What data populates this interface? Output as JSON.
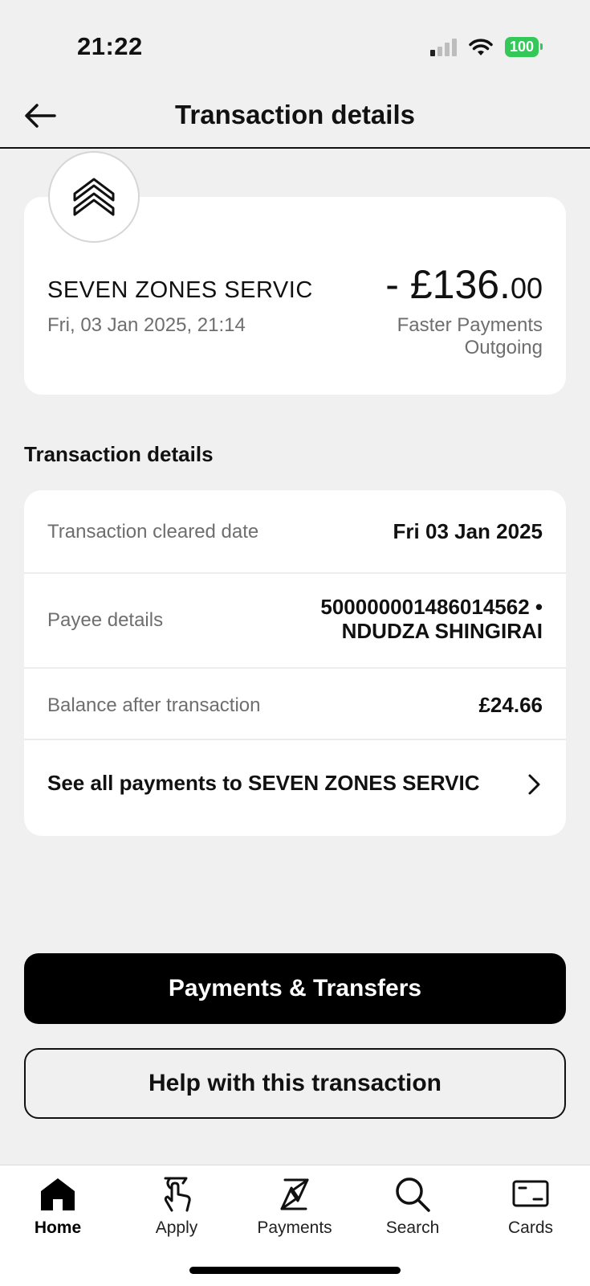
{
  "status_bar": {
    "time": "21:22",
    "battery": "100"
  },
  "header": {
    "title": "Transaction details",
    "back_icon": "arrow-left-icon"
  },
  "summary": {
    "merchant": "SEVEN ZONES SERVIC",
    "datetime": "Fri, 03 Jan 2025, 21:14",
    "amount_major": "- £136.",
    "amount_minor": "00",
    "type_line1": "Faster Payments",
    "type_line2": "Outgoing",
    "logo_icon": "double-chevron-up-icon"
  },
  "details": {
    "section_title": "Transaction details",
    "cleared_label": "Transaction cleared date",
    "cleared_value": "Fri 03 Jan 2025",
    "payee_label": "Payee details",
    "payee_value_line1": "500000001486014562 •",
    "payee_value_line2": "NDUDZA SHINGIRAI",
    "balance_label": "Balance after transaction",
    "balance_value": "£24.66",
    "see_all_label": "See all payments to SEVEN ZONES SERVIC"
  },
  "buttons": {
    "primary": "Payments & Transfers",
    "secondary": "Help with this transaction"
  },
  "nav": {
    "items": [
      {
        "label": "Home",
        "icon": "home-icon",
        "active": true
      },
      {
        "label": "Apply",
        "icon": "tap-hand-icon",
        "active": false
      },
      {
        "label": "Payments",
        "icon": "payments-arrows-icon",
        "active": false
      },
      {
        "label": "Search",
        "icon": "search-icon",
        "active": false
      },
      {
        "label": "Cards",
        "icon": "card-icon",
        "active": false
      }
    ]
  },
  "colors": {
    "background": "#f0f0f0",
    "card": "#ffffff",
    "primary": "#000000",
    "battery": "#34c759",
    "muted_text": "#6e6e6e"
  }
}
